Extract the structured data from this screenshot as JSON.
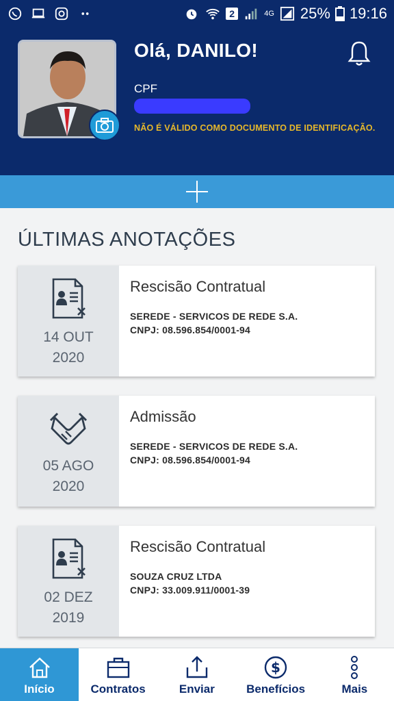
{
  "status_bar": {
    "battery": "25%",
    "time": "19:16",
    "sim_badge": "2",
    "network": "4G"
  },
  "header": {
    "greeting": "Olá, DANILO!",
    "cpf_label": "CPF",
    "cpf_note": "NÃO É VÁLIDO COMO DOCUMENTO DE IDENTIFICAÇÃO."
  },
  "section_title": "ÚLTIMAS ANOTAÇÕES",
  "cards": [
    {
      "icon": "document-x-icon",
      "day_month": "14 OUT",
      "year": "2020",
      "title": "Rescisão Contratual",
      "company": "SEREDE - SERVICOS DE REDE S.A.",
      "cnpj": "CNPJ: 08.596.854/0001-94"
    },
    {
      "icon": "handshake-icon",
      "day_month": "05 AGO",
      "year": "2020",
      "title": "Admissão",
      "company": "SEREDE - SERVICOS DE REDE S.A.",
      "cnpj": "CNPJ: 08.596.854/0001-94"
    },
    {
      "icon": "document-x-icon",
      "day_month": "02 DEZ",
      "year": "2019",
      "title": "Rescisão Contratual",
      "company": "SOUZA CRUZ LTDA",
      "cnpj": "CNPJ: 33.009.911/0001-39"
    }
  ],
  "nav": [
    {
      "label": "Início",
      "icon": "home-icon"
    },
    {
      "label": "Contratos",
      "icon": "briefcase-icon"
    },
    {
      "label": "Enviar",
      "icon": "upload-icon"
    },
    {
      "label": "Benefícios",
      "icon": "dollar-icon"
    },
    {
      "label": "Mais",
      "icon": "more-icon"
    }
  ],
  "colors": {
    "header_bg": "#0b2a6b",
    "accent": "#2f97d5",
    "note": "#e7b82b"
  }
}
